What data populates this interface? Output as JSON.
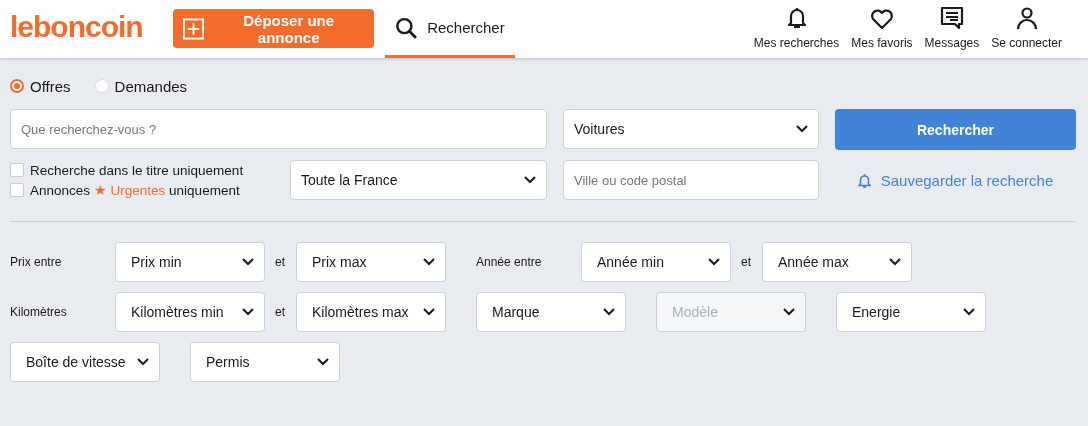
{
  "header": {
    "logo": "leboncoin",
    "post_button": "Déposer une annonce",
    "search_tab": {
      "label": "Rechercher",
      "selected": true
    },
    "nav": [
      {
        "kind": "bell",
        "label": "Mes recherches"
      },
      {
        "kind": "heart",
        "label": "Mes favoris"
      },
      {
        "kind": "message",
        "label": "Messages"
      },
      {
        "kind": "person",
        "label": "Se connecter"
      }
    ]
  },
  "search": {
    "ad_types": [
      {
        "label": "Offres",
        "selected": true
      },
      {
        "label": "Demandes",
        "selected": false
      }
    ],
    "query": {
      "placeholder": "Que recherchez-vous ?"
    },
    "category": "Voitures",
    "submit": "Rechercher",
    "options": [
      {
        "text": "Recherche dans le titre uniquement",
        "checked": false
      },
      {
        "text": "Annonces ★ **Urgentes** uniquement",
        "checked": false
      }
    ],
    "region": "Toute la France",
    "location": {
      "placeholder": "Ville ou code postal"
    },
    "save_link": "Sauvegarder la recherche"
  },
  "filters": [
    [
      {
        "kind": "label",
        "text": "Prix entre"
      },
      {
        "kind": "select",
        "text": "Prix min",
        "disabled": false
      },
      {
        "kind": "joiner",
        "text": "et"
      },
      {
        "kind": "select",
        "text": "Prix max",
        "disabled": false
      },
      {
        "kind": "label",
        "text": "Année entre"
      },
      {
        "kind": "select",
        "text": "Année min",
        "disabled": false
      },
      {
        "kind": "joiner",
        "text": "et"
      },
      {
        "kind": "select",
        "text": "Année max",
        "disabled": false
      }
    ],
    [
      {
        "kind": "label",
        "text": "Kilomètres"
      },
      {
        "kind": "select",
        "text": "Kilomètres min",
        "disabled": false
      },
      {
        "kind": "joiner",
        "text": "et"
      },
      {
        "kind": "select",
        "text": "Kilomètres max",
        "disabled": false
      },
      {
        "kind": "select",
        "text": "Marque",
        "disabled": false
      },
      {
        "kind": "select",
        "text": "Modèle",
        "disabled": true
      },
      {
        "kind": "select",
        "text": "Energie",
        "disabled": false
      }
    ],
    [
      {
        "kind": "select",
        "text": "Boîte de vitesse",
        "disabled": false
      },
      {
        "kind": "select",
        "text": "Permis",
        "disabled": false
      }
    ]
  ]
}
